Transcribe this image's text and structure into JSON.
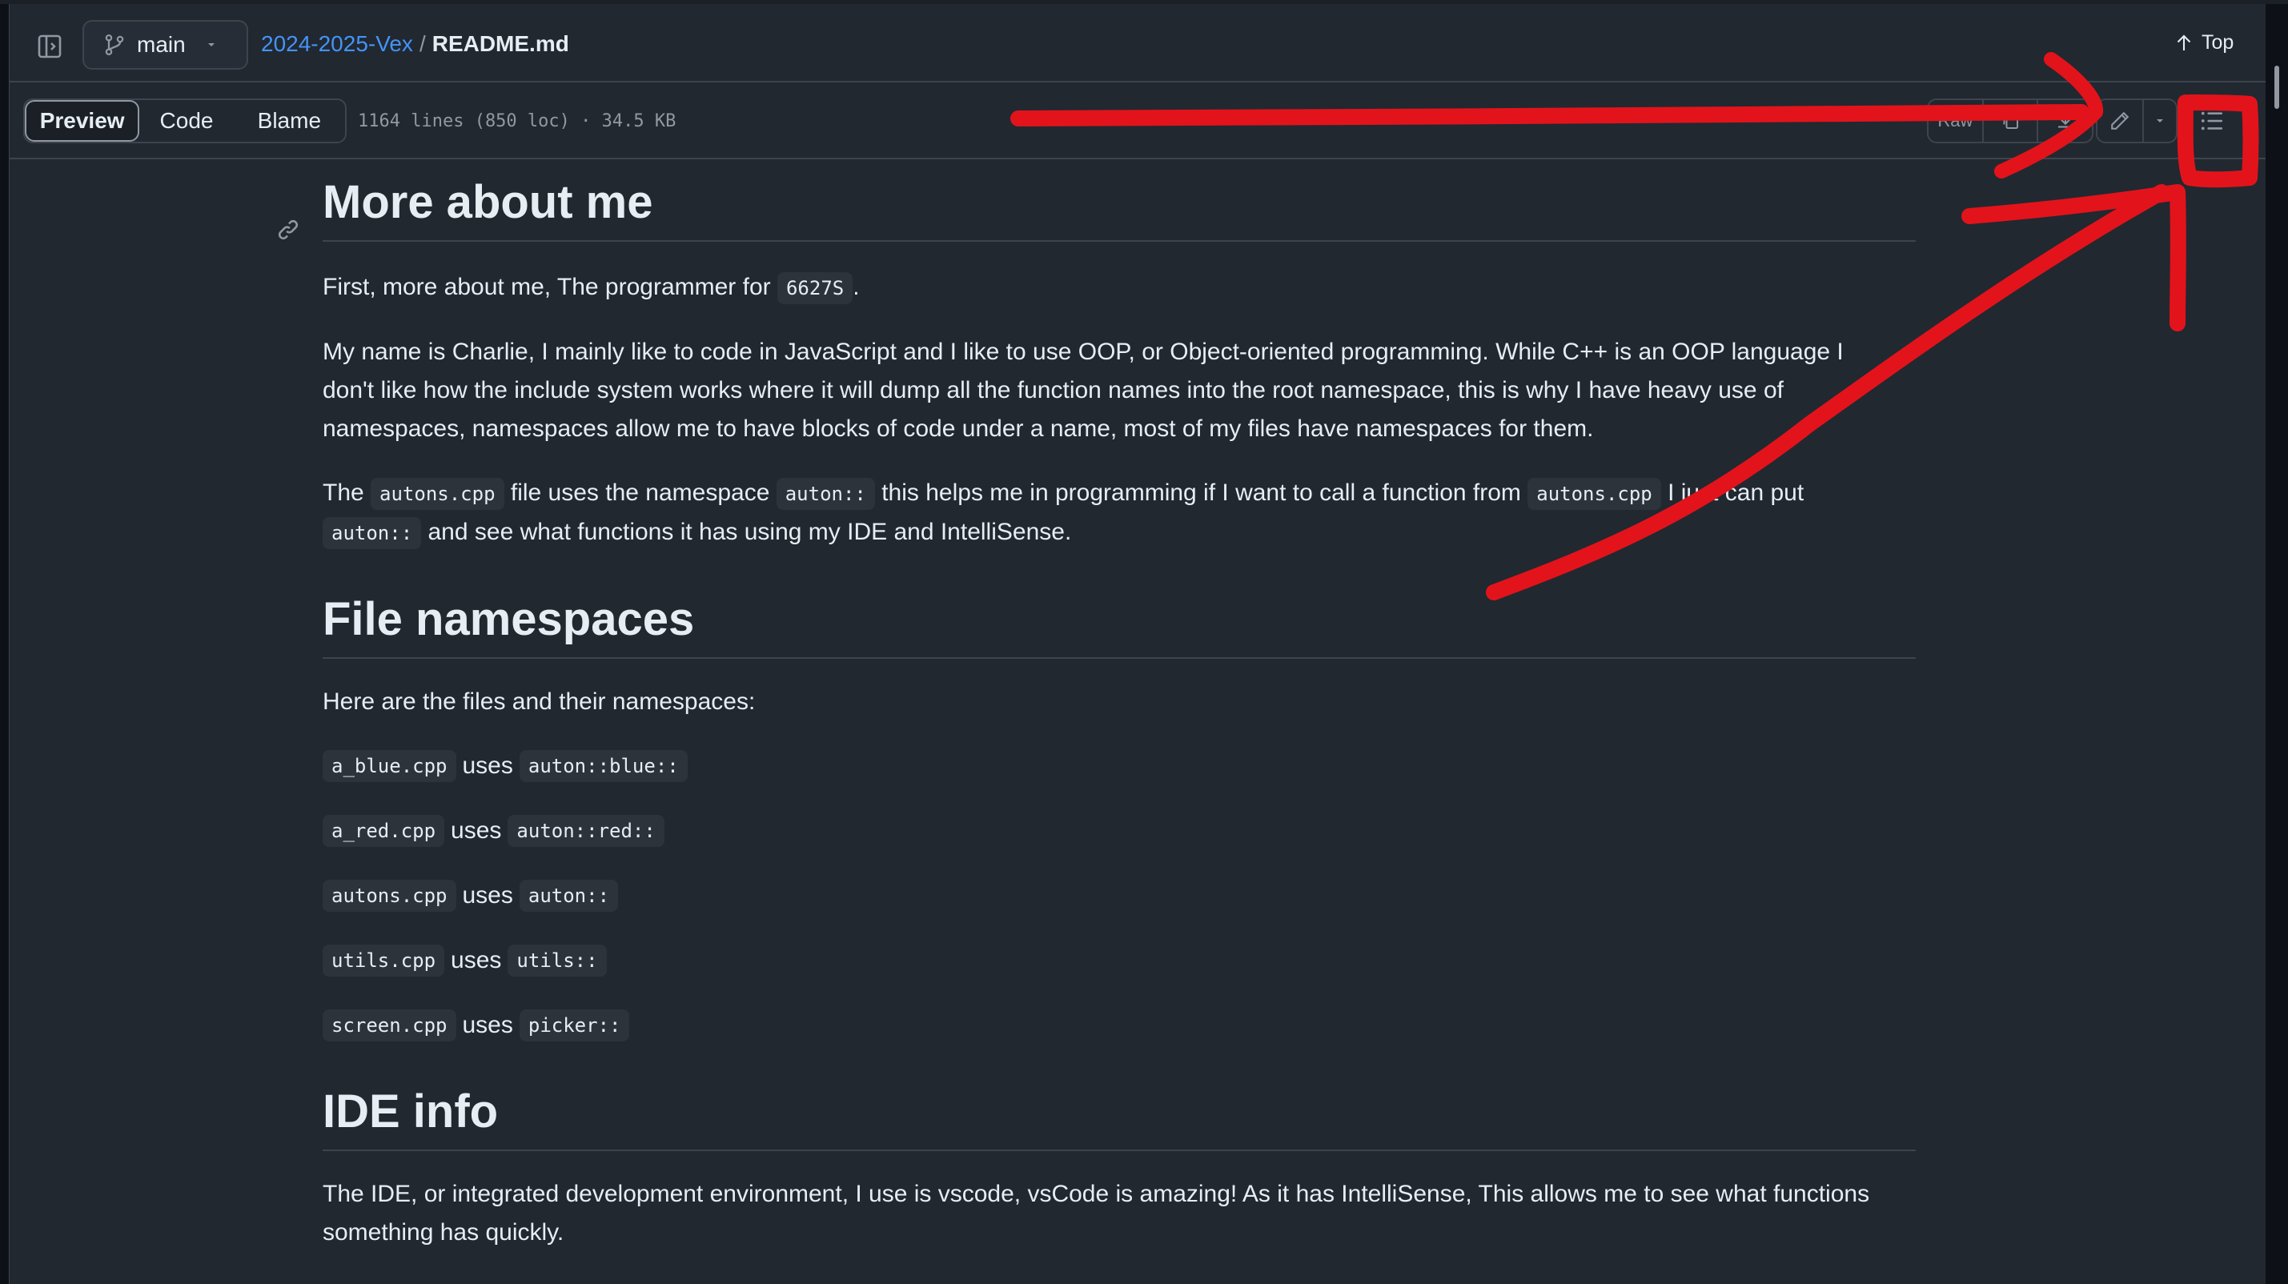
{
  "header": {
    "branch": "main",
    "repo_link": "2024-2025-Vex",
    "separator": "/",
    "file_name": "README.md",
    "top_label": "Top"
  },
  "toolbar": {
    "tabs": [
      "Preview",
      "Code",
      "Blame"
    ],
    "file_info": "1164 lines (850 loc) · 34.5 KB",
    "raw_label": "Raw"
  },
  "content": {
    "h1_about": "More about me",
    "p1_text": "First, more about me, The programmer for ",
    "p1_code": "6627S",
    "p1_end": ".",
    "p2_line1": "My name is Charlie, I mainly like to code in JavaScript and I like to use OOP, or Object-oriented programming. While C++ is an OOP language I",
    "p2_line2": "don't like how the include system works where it will dump all the function names into the root namespace, this is why I have heavy use of",
    "p2_line3": "namespaces, namespaces allow me to have blocks of code under a name, most of my files have namespaces for them.",
    "p3_a": "The ",
    "p3_code1": "autons.cpp",
    "p3_b": " file uses the namespace ",
    "p3_code2": "auton::",
    "p3_c": " this helps me in programming if I want to call a function from ",
    "p3_code3": "autons.cpp",
    "p3_d": " I just can put",
    "p3_code4": "auton::",
    "p3_e": " and see what functions it has using my IDE and IntelliSense.",
    "h1_ns": "File namespaces",
    "ns_intro": "Here are the files and their namespaces:",
    "uses_word": "uses",
    "files": [
      {
        "file": "a_blue.cpp",
        "ns": "auton::blue::"
      },
      {
        "file": "a_red.cpp",
        "ns": "auton::red::"
      },
      {
        "file": "autons.cpp",
        "ns": "auton::"
      },
      {
        "file": "utils.cpp",
        "ns": "utils::"
      },
      {
        "file": "screen.cpp",
        "ns": "picker::"
      }
    ],
    "h1_ide": "IDE info",
    "ide_line1": "The IDE, or integrated development environment, I use is vscode, vsCode is amazing! As it has IntelliSense, This allows me to see what functions",
    "ide_line2": "something has quickly."
  },
  "icons": [
    "sidebar-toggle-icon",
    "git-branch-icon",
    "caret-down-icon",
    "arrow-up-icon",
    "copy-icon",
    "download-icon",
    "pencil-icon",
    "list-outline-icon",
    "link-icon"
  ],
  "colors": {
    "accent_link": "#4493f8",
    "background": "#212830",
    "annotation": "#e3131b"
  }
}
